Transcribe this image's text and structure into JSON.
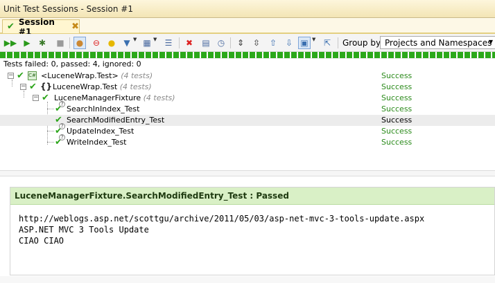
{
  "window": {
    "title": "Unit Test Sessions - Session #1"
  },
  "tab": {
    "label": "Session #1"
  },
  "toolbar": {
    "group_by_label": "Group by:",
    "group_by_value": "Projects and Namespaces"
  },
  "progress": {
    "fraction": 1.0,
    "color": "#2ba81a"
  },
  "summary": {
    "text": "Tests failed: 0, passed: 4, ignored: 0"
  },
  "tree": {
    "rows": [
      {
        "label": "<LuceneWrap.Test>",
        "count": "(4 tests)",
        "status": "Success"
      },
      {
        "label": "LuceneWrap.Test",
        "count": "(4 tests)",
        "status": "Success"
      },
      {
        "label": "LuceneManagerFixture",
        "count": "(4 tests)",
        "status": "Success"
      },
      {
        "label": "SearchInIndex_Test",
        "count": "",
        "status": "Success"
      },
      {
        "label": "SearchModifiedEntry_Test",
        "count": "",
        "status": "Success"
      },
      {
        "label": "UpdateIndex_Test",
        "count": "",
        "status": "Success"
      },
      {
        "label": "WriteIndex_Test",
        "count": "",
        "status": "Success"
      }
    ]
  },
  "result": {
    "header": "LuceneManagerFixture.SearchModifiedEntry_Test : Passed",
    "output": [
      "http://weblogs.asp.net/scottgu/archive/2011/05/03/asp-net-mvc-3-tools-update.aspx",
      "ASP.NET MVC 3 Tools Update",
      "CIAO CIAO"
    ]
  },
  "colors": {
    "success": "#2a8a1a",
    "passed_header_bg": "#d9f0c6",
    "title_bg": "#f3e5b5"
  }
}
